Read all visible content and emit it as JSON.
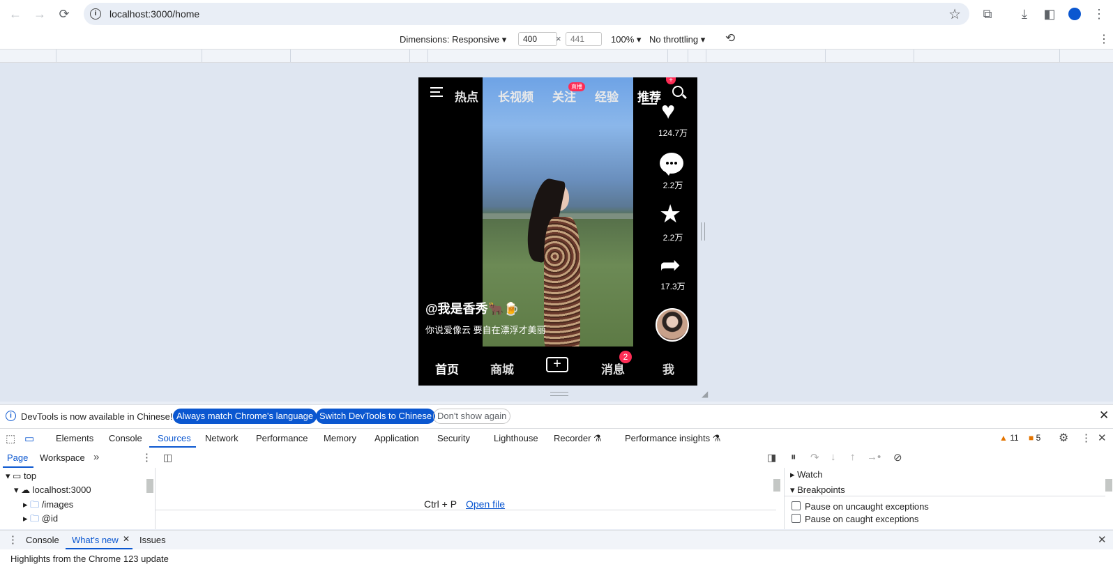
{
  "browser": {
    "url": "localhost:3000/home"
  },
  "device_toolbar": {
    "dimensions": "Dimensions: Responsive",
    "width": "400",
    "height": "441",
    "zoom": "100%",
    "throttling": "No throttling"
  },
  "app": {
    "top_nav": [
      "热点",
      "长视频",
      "关注",
      "经验",
      "推荐"
    ],
    "live_badge": "直播",
    "likes": "124.7万",
    "comments": "2.2万",
    "favorites": "2.2万",
    "shares": "17.3万",
    "author": "@我是香秀🐂🍺",
    "caption": "你说爱像云 要自在漂浮才美丽",
    "bottom_tabs": [
      "首页",
      "商城",
      "消息",
      "我"
    ],
    "message_badge": "2",
    "active_tab": "首页"
  },
  "devtools": {
    "info_message": "DevTools is now available in Chinese!",
    "btn_match": "Always match Chrome's language",
    "btn_switch": "Switch DevTools to Chinese",
    "btn_dont_show": "Don't show again",
    "tabs": [
      "Elements",
      "Console",
      "Sources",
      "Network",
      "Performance",
      "Memory",
      "Application",
      "Security",
      "Lighthouse",
      "Recorder",
      "Performance insights"
    ],
    "active_tab": "Sources",
    "warnings": "11",
    "issues": "5",
    "sub_tabs": [
      "Page",
      "Workspace"
    ],
    "tree": {
      "top": "top",
      "host": "localhost:3000",
      "images": "/images",
      "id": "@id"
    },
    "shortcut": "Ctrl + P",
    "open_file": "Open file",
    "watch": "Watch",
    "breakpoints": "Breakpoints",
    "pause_uncaught": "Pause on uncaught exceptions",
    "pause_caught": "Pause on caught exceptions",
    "drawer_tabs": [
      "Console",
      "What's new",
      "Issues"
    ],
    "drawer_active": "What's new",
    "drawer_text": "Highlights from the Chrome 123 update"
  },
  "colors": {
    "accent": "#0b57d0",
    "badge": "#fe2c55",
    "warning": "#e37400"
  }
}
